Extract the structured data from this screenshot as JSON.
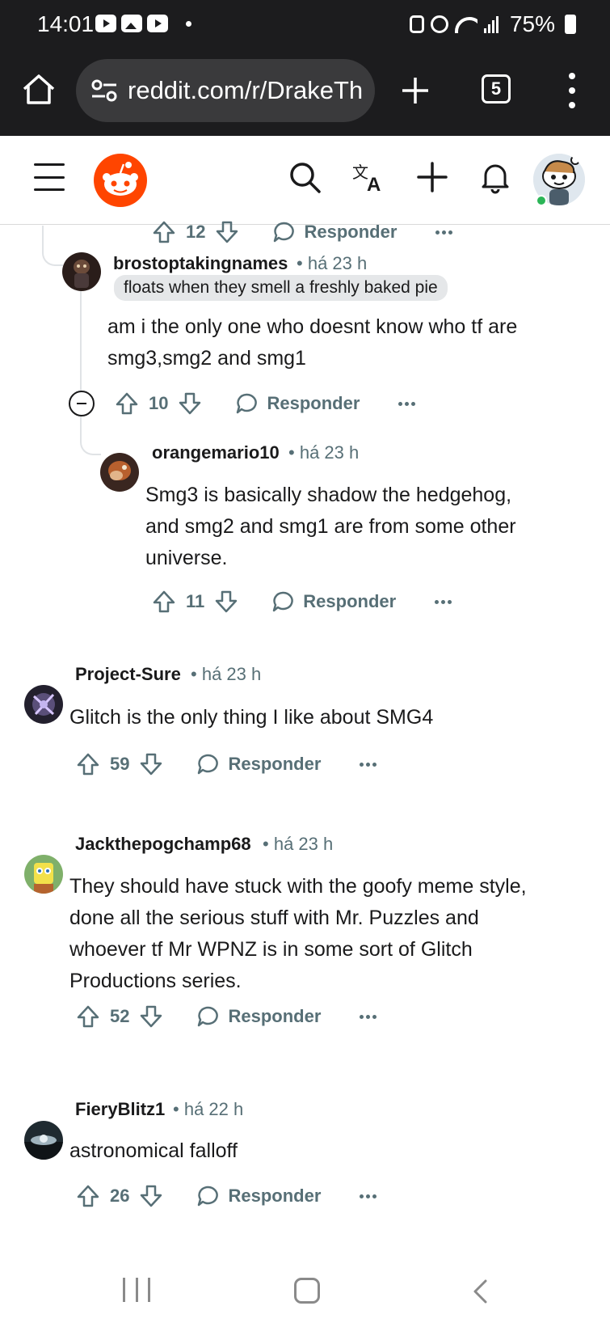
{
  "status_bar": {
    "time": "14:01",
    "battery": "75%",
    "notification_icons": [
      "youtube-icon",
      "gallery-icon",
      "youtube-icon"
    ]
  },
  "browser": {
    "url": "reddit.com/r/DrakeTh",
    "tab_count": "5"
  },
  "reddit_header": {
    "icons": [
      "menu-icon",
      "reddit-logo",
      "search-icon",
      "translate-icon",
      "create-post-icon",
      "notifications-icon",
      "user-avatar"
    ]
  },
  "comments": [
    {
      "actions": {
        "score": "12",
        "reply_label": "Responder"
      }
    },
    {
      "author": "brostoptakingnames",
      "time": "há 23 h",
      "flair": "floats when they smell a freshly baked pie",
      "body_lines": [
        "am i the only one who doesnt know who tf are",
        "smg3,smg2 and smg1"
      ],
      "actions": {
        "score": "10",
        "reply_label": "Responder"
      }
    },
    {
      "author": "orangemario10",
      "time": "há 23 h",
      "body_lines": [
        "Smg3 is basically shadow the hedgehog,",
        "and smg2 and smg1 are from some other",
        "universe."
      ],
      "actions": {
        "score": "11",
        "reply_label": "Responder"
      }
    },
    {
      "author": "Project-Sure",
      "time": "há 23 h",
      "body_lines": [
        "Glitch is the only thing I like about SMG4"
      ],
      "actions": {
        "score": "59",
        "reply_label": "Responder"
      }
    },
    {
      "author": "Jackthepogchamp68",
      "time": "há 23 h",
      "body_lines": [
        "They should have stuck with the goofy meme style,",
        "done all the serious stuff with Mr. Puzzles and",
        "whoever tf Mr WPNZ is in some sort of Glitch",
        "Productions series."
      ],
      "actions": {
        "score": "52",
        "reply_label": "Responder"
      }
    },
    {
      "author": "FieryBlitz1",
      "time": "há 22 h",
      "body_lines": [
        "astronomical falloff"
      ],
      "actions": {
        "score": "26",
        "reply_label": "Responder"
      }
    }
  ],
  "colors": {
    "reddit_orange": "#ff4500",
    "meta_gray": "#576f76",
    "online_green": "#2bb557",
    "system_bar": "#1c1c1e"
  }
}
